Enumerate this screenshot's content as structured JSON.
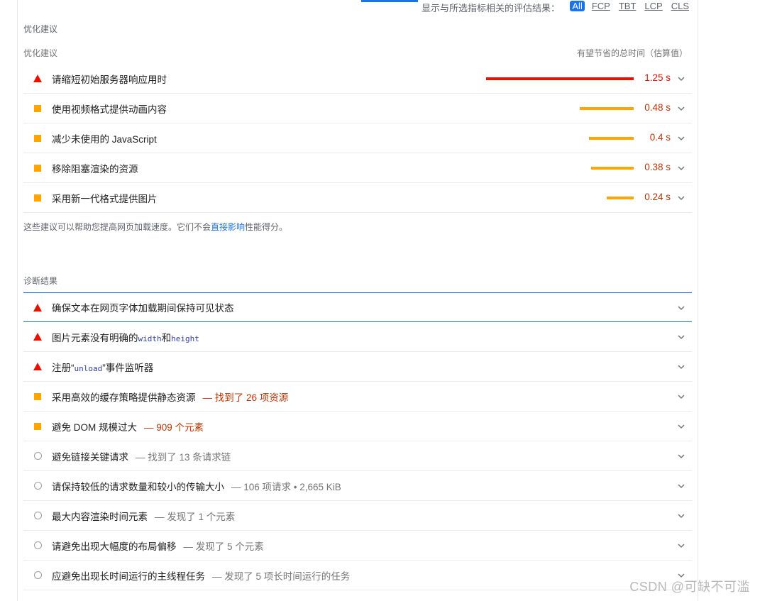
{
  "filter_bar": {
    "label": "显示与所选指标相关的评估结果：",
    "metrics": [
      "All",
      "FCP",
      "TBT",
      "LCP",
      "CLS"
    ],
    "active": "All"
  },
  "opportunities": {
    "section_title": "优化建议",
    "column_left": "优化建议",
    "column_right": "有望节省的总时间（估算值）",
    "items": [
      {
        "severity": "fail",
        "title": "请缩短初始服务器响应用时",
        "savings": "1.25 s",
        "savings_seconds": 1.25
      },
      {
        "severity": "average",
        "title": "使用视频格式提供动画内容",
        "savings": "0.48 s",
        "savings_seconds": 0.48
      },
      {
        "severity": "average",
        "title": "减少未使用的 JavaScript",
        "savings": "0.4 s",
        "savings_seconds": 0.4
      },
      {
        "severity": "average",
        "title": "移除阻塞渲染的资源",
        "savings": "0.38 s",
        "savings_seconds": 0.38
      },
      {
        "severity": "average",
        "title": "采用新一代格式提供图片",
        "savings": "0.24 s",
        "savings_seconds": 0.24
      }
    ],
    "note_before": "这些建议可以帮助您提高网页加载速度。它们不会",
    "note_link": "直接影响",
    "note_after": "性能得分。"
  },
  "diagnostics": {
    "section_title": "诊断结果",
    "items": [
      {
        "severity": "fail",
        "title": "确保文本在网页字体加载期间保持可见状态",
        "detail": ""
      },
      {
        "severity": "fail",
        "title_parts": [
          "图片元素没有明确的",
          "width",
          "和",
          "height"
        ],
        "detail": ""
      },
      {
        "severity": "fail",
        "title_parts": [
          "注册“",
          "unload",
          "”事件监听器"
        ],
        "detail": ""
      },
      {
        "severity": "average",
        "title": "采用高效的缓存策略提供静态资源",
        "detail": "— 找到了 26 项资源"
      },
      {
        "severity": "average",
        "title": "避免 DOM 规模过大",
        "detail": "— 909 个元素"
      },
      {
        "severity": "info",
        "title": "避免链接关键请求",
        "detail": "— 找到了 13 条请求链"
      },
      {
        "severity": "info",
        "title": "请保持较低的请求数量和较小的传输大小",
        "detail": "— 106 项请求 • 2,665 KiB"
      },
      {
        "severity": "info",
        "title": "最大内容渲染时间元素",
        "detail": "— 发现了 1 个元素"
      },
      {
        "severity": "info",
        "title": "请避免出现大幅度的布局偏移",
        "detail": "— 发现了 5 个元素"
      },
      {
        "severity": "info",
        "title": "应避免出现长时间运行的主线程任务",
        "detail": "— 发现了 5 项长时间运行的任务"
      }
    ]
  },
  "watermark": "CSDN @可缺不可滥",
  "colors": {
    "fail": "#eb0f00",
    "average": "#ffa400",
    "info": "#9e9e9e",
    "link": "#1a73e8"
  }
}
